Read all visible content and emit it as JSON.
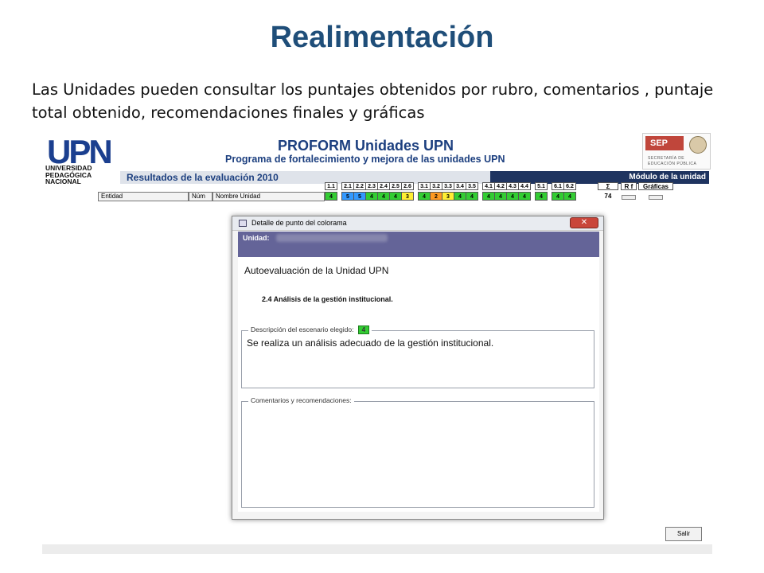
{
  "slide": {
    "title": "Realimentación",
    "body": "Las Unidades pueden consultar los puntajes obtenidos por rubro, comentarios , puntaje total obtenido, recomendaciones finales y gráficas"
  },
  "app": {
    "logo_mark": "UPN",
    "logo_lines": [
      "UNIVERSIDAD",
      "PEDAGÓGICA",
      "NACIONAL"
    ],
    "banner_title": "PROFORM Unidades UPN",
    "banner_subtitle": "Programa de fortalecimiento y mejora de las unidades UPN",
    "sep_badge": "SEP",
    "sep_lines": [
      "SECRETARÍA DE",
      "EDUCACIÓN PÚBLICA"
    ],
    "results_title": "Resultados de la evaluación 2010",
    "module_title": "Módulo de la unidad"
  },
  "table": {
    "headers": [
      "Entidad",
      "Núm",
      "Nombre Unidad"
    ],
    "sum_label": "Σ",
    "sum_value": "74",
    "rf_label": "R f",
    "graphs_label": "Gráficas",
    "scores": [
      {
        "code": "1.1",
        "value": "4",
        "color": "#33cc33"
      },
      {
        "code": "2.1",
        "value": "5",
        "color": "#3399ff"
      },
      {
        "code": "2.2",
        "value": "5",
        "color": "#3399ff"
      },
      {
        "code": "2.3",
        "value": "4",
        "color": "#33cc33"
      },
      {
        "code": "2.4",
        "value": "4",
        "color": "#33cc33"
      },
      {
        "code": "2.5",
        "value": "4",
        "color": "#33cc33"
      },
      {
        "code": "2.6",
        "value": "3",
        "color": "#ffee33"
      },
      {
        "code": "3.1",
        "value": "4",
        "color": "#33cc33"
      },
      {
        "code": "3.2",
        "value": "2",
        "color": "#ff9922"
      },
      {
        "code": "3.3",
        "value": "3",
        "color": "#ffee33"
      },
      {
        "code": "3.4",
        "value": "4",
        "color": "#33cc33"
      },
      {
        "code": "3.5",
        "value": "4",
        "color": "#33cc33"
      },
      {
        "code": "4.1",
        "value": "4",
        "color": "#33cc33"
      },
      {
        "code": "4.2",
        "value": "4",
        "color": "#33cc33"
      },
      {
        "code": "4.3",
        "value": "4",
        "color": "#33cc33"
      },
      {
        "code": "4.4",
        "value": "4",
        "color": "#33cc33"
      },
      {
        "code": "5.1",
        "value": "4",
        "color": "#33cc33"
      },
      {
        "code": "6.1",
        "value": "4",
        "color": "#33cc33"
      },
      {
        "code": "6.2",
        "value": "4",
        "color": "#33cc33"
      }
    ]
  },
  "dialog": {
    "title": "Detalle de punto del colorama",
    "close_label": "✕",
    "unit_label": "Unidad:",
    "heading": "Autoevaluación de la Unidad UPN",
    "subheading": "2.4 Análisis de la gestión institucional.",
    "scenario_legend": "Descripción del escenario elegido:",
    "scenario_value": "4",
    "scenario_text": "Se realiza un análisis adecuado de la gestión institucional.",
    "comments_legend": "Comentarios y recomendaciones:",
    "comments_text": ""
  },
  "footer": {
    "exit_label": "Salir"
  }
}
